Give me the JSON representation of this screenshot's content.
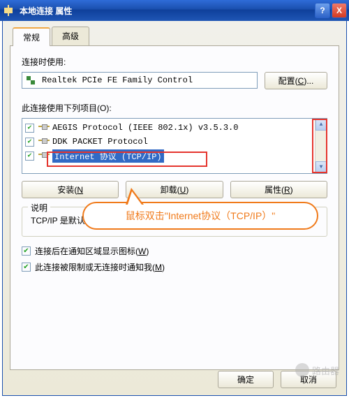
{
  "titlebar": {
    "title": "本地连接 属性",
    "help": "?",
    "close": "X"
  },
  "tabs": {
    "general": "常规",
    "advanced": "高级"
  },
  "connect_using_label": "连接时使用:",
  "adapter_name": "Realtek PCIe FE Family Control",
  "configure_btn": "配置(C)...",
  "items_label": "此连接使用下列项目(O):",
  "items": [
    {
      "checked": true,
      "label": "AEGIS Protocol (IEEE 802.1x) v3.5.3.0",
      "selected": false
    },
    {
      "checked": true,
      "label": "DDK PACKET Protocol",
      "selected": false
    },
    {
      "checked": true,
      "label": "Internet 协议 (TCP/IP)",
      "selected": true
    }
  ],
  "buttons": {
    "install": "安装(N",
    "uninstall": "卸载(U)",
    "properties": "属性(R)"
  },
  "desc": {
    "legend": "说明",
    "text": "TCP/IP 是默认的广域网协议。它提供跨越多种互联网络的通讯。"
  },
  "checks": {
    "show_icon": "连接后在通知区域显示图标(W)",
    "notify": "此连接被限制或无连接时通知我(M)"
  },
  "dialog": {
    "ok": "确定",
    "cancel": "取消"
  },
  "callout_text": "鼠标双击\"Internet协议（TCP/IP）\"",
  "watermark": "路由器"
}
